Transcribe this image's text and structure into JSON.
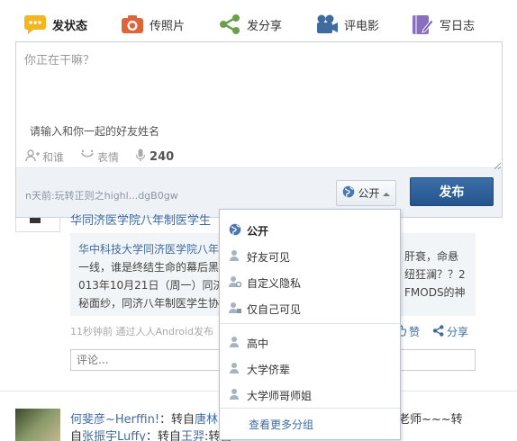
{
  "tabs": [
    {
      "label": "发状态",
      "icon": "speech-bubble-icon",
      "color": "#f5b520"
    },
    {
      "label": "传照片",
      "icon": "camera-icon",
      "color": "#e0643a"
    },
    {
      "label": "发分享",
      "icon": "share-icon",
      "color": "#6a9f4c"
    },
    {
      "label": "评电影",
      "icon": "film-camera-icon",
      "color": "#3f6ba1"
    },
    {
      "label": "写日志",
      "icon": "notebook-icon",
      "color": "#8a6fc1"
    }
  ],
  "composer": {
    "placeholder": "你正在干嘛？",
    "friends_hint": "请输入和你一起的好友姓名",
    "with_label": "和谁",
    "emoji_label": "表情",
    "char_count": "240",
    "recent_text": "n天前:玩转正则之highl...dgB0gw",
    "privacy_label": "公开",
    "publish_label": "发布"
  },
  "feed1": {
    "title_fragment": "华同济医学院八年制医学生",
    "quote_lines_left": [
      "华中科技大学同济医学院八年",
      "一线，谁是终结生命的幕后黑",
      "013年10月21日（周一）同济",
      "秘面纱，同济八年制医学生协"
    ],
    "quote_lines_right": [
      "肝衰，命悬",
      "纽狂澜？？2",
      "FMODS的神"
    ],
    "time_text": "11秒钟前  通过人人Android发布",
    "like_label": "赞",
    "share_label": "分享",
    "comment_placeholder": "评论..."
  },
  "feed2": {
    "line1_name": "何斐彦~Herffin!",
    "line1_mid": "：转自",
    "line1_name2": "唐林",
    "line1_right": "老师~~~转",
    "line2_prefix": "自",
    "line2_name": "张振宇Luffy",
    "line2_mid": "：转自",
    "line2_name3": "王羿",
    "line2_tail": ":转自"
  },
  "privacy_menu": {
    "items": [
      {
        "label": "公开",
        "icon": "globe-icon",
        "selected": true
      },
      {
        "label": "好友可见",
        "icon": "friend-icon"
      },
      {
        "label": "自定义隐私",
        "icon": "custom-privacy-icon"
      },
      {
        "label": "仅自己可见",
        "icon": "lock-user-icon"
      }
    ],
    "groups": [
      {
        "label": "高中",
        "icon": "group-icon"
      },
      {
        "label": "大学侪辈",
        "icon": "group-icon"
      },
      {
        "label": "大学师哥师姐",
        "icon": "group-icon"
      }
    ],
    "more_label": "查看更多分组"
  },
  "colors": {
    "link": "#3f6ba1",
    "publish": "#2e5f98"
  }
}
